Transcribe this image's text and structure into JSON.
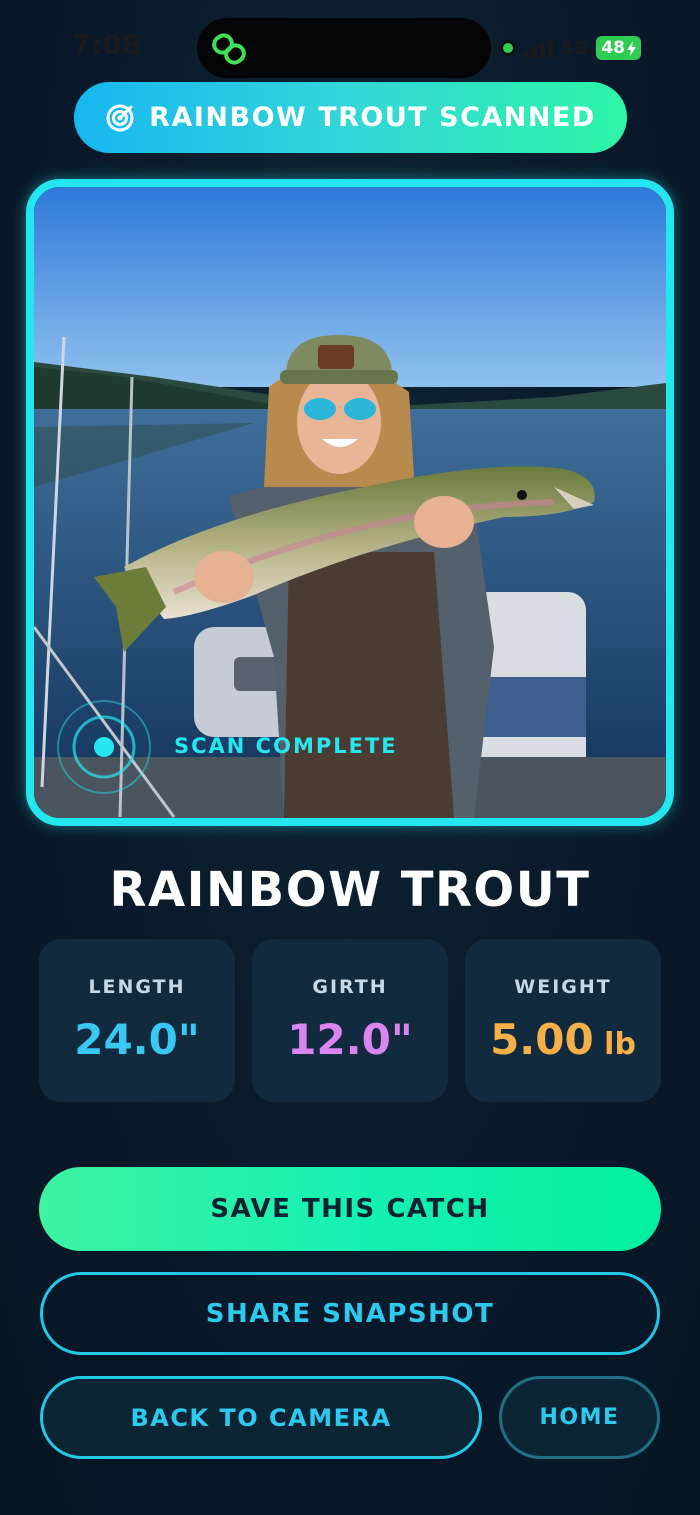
{
  "status_bar": {
    "time": "7:08",
    "network": "5G",
    "battery": "48"
  },
  "banner": {
    "icon": "radar-icon",
    "text": "RAINBOW TROUT SCANNED"
  },
  "photo": {
    "icon": "scan-target-icon",
    "scan_label": "SCAN COMPLETE"
  },
  "species": {
    "name": "RAINBOW TROUT"
  },
  "stats": [
    {
      "label": "LENGTH",
      "value": "24.0\"",
      "unit": "",
      "color": "#38c8f2"
    },
    {
      "label": "GIRTH",
      "value": "12.0\"",
      "unit": "",
      "color": "#db86f0"
    },
    {
      "label": "WEIGHT",
      "value": "5.00",
      "unit": " lb",
      "color": "#f5b04a"
    }
  ],
  "actions": {
    "save": "SAVE THIS CATCH",
    "share": "SHARE SNAPSHOT",
    "back": "BACK TO CAMERA",
    "home": "HOME"
  },
  "colors": {
    "accent_cyan": "#23e6ee",
    "accent_green": "#2ef5a6",
    "background": "#0a1c28"
  }
}
